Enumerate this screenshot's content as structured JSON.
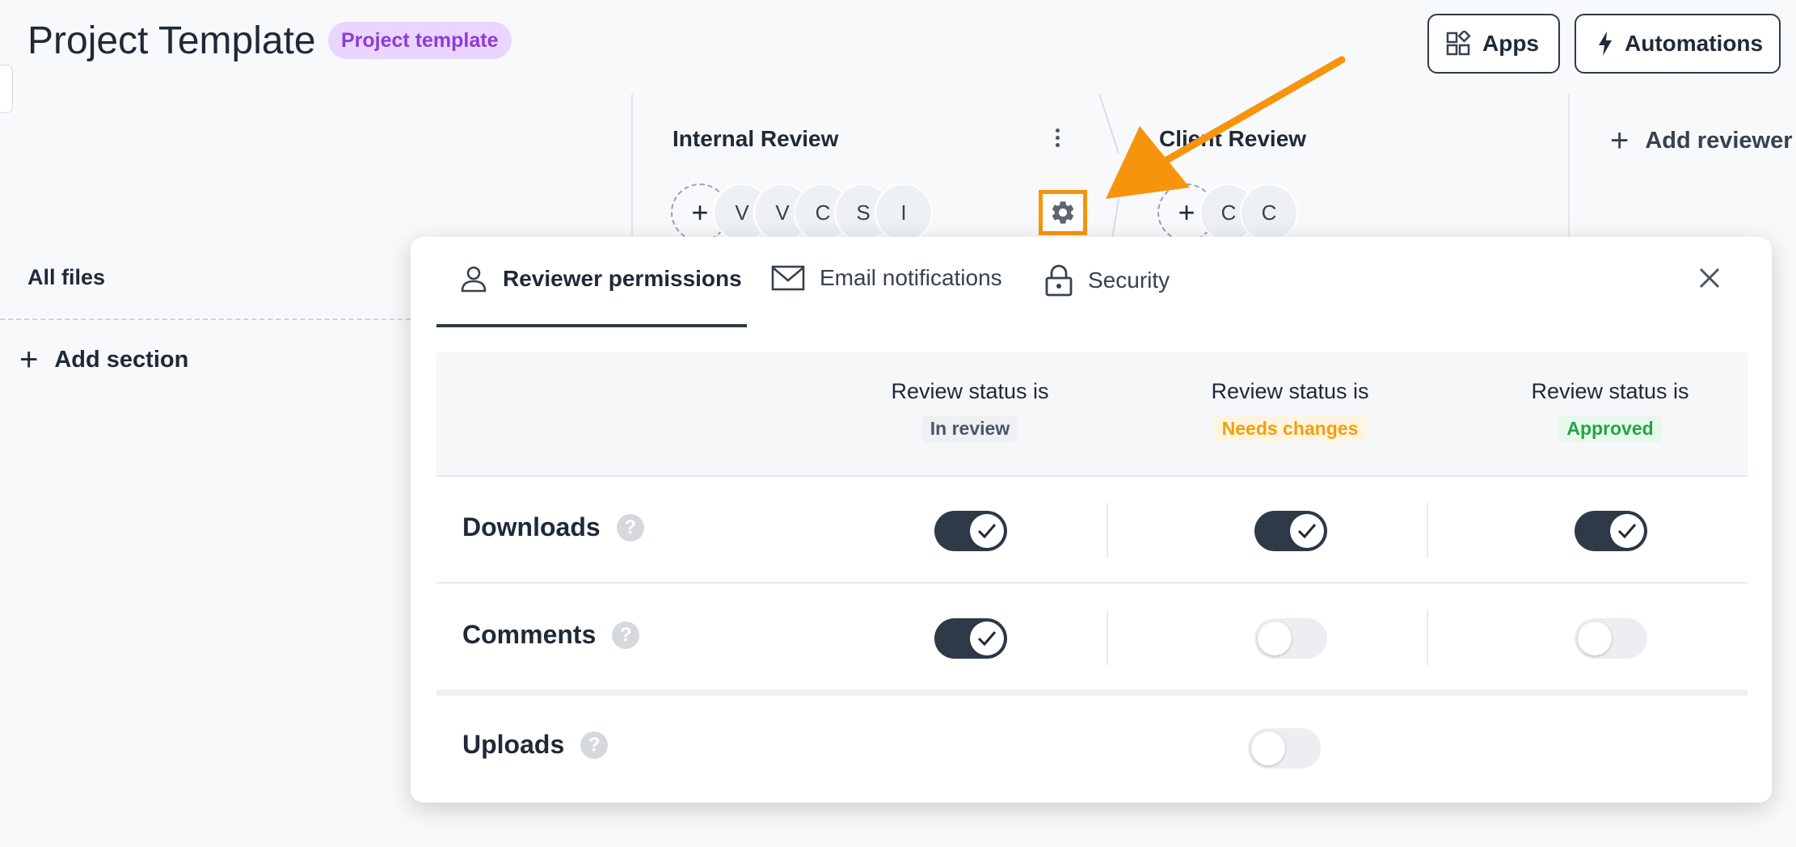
{
  "header": {
    "title": "Project Template",
    "badge": "Project template",
    "apps_label": "Apps",
    "automations_label": "Automations"
  },
  "sidebar": {
    "all_files": "All files",
    "add_section": "Add section"
  },
  "columns": [
    {
      "title": "Internal Review",
      "avatars": [
        "V",
        "V",
        "C",
        "S",
        "I"
      ]
    },
    {
      "title": "Client Review",
      "avatars": [
        "C",
        "C"
      ]
    }
  ],
  "add_reviewer": "Add reviewer",
  "modal": {
    "tabs": [
      {
        "label": "Reviewer permissions",
        "icon": "user-icon",
        "active": true
      },
      {
        "label": "Email notifications",
        "icon": "mail-icon",
        "active": false
      },
      {
        "label": "Security",
        "icon": "lock-icon",
        "active": false
      }
    ],
    "status_prefix": "Review status is",
    "statuses": [
      {
        "label": "In review",
        "color": "#4b5563",
        "bg": "#eef0f3"
      },
      {
        "label": "Needs changes",
        "color": "#f59e0b",
        "bg": "#fff4e0"
      },
      {
        "label": "Approved",
        "color": "#22a447",
        "bg": "#e8f7ec"
      }
    ],
    "rows": [
      {
        "label": "Downloads",
        "help": "?",
        "values": [
          true,
          true,
          true
        ]
      },
      {
        "label": "Comments",
        "help": "?",
        "values": [
          true,
          false,
          false
        ]
      },
      {
        "label": "Uploads",
        "help": "?",
        "value": false
      }
    ]
  },
  "colors": {
    "accent_orange": "#f7940d",
    "toggle_on": "#2f3a48",
    "badge_purple": "#8e3bd7"
  }
}
